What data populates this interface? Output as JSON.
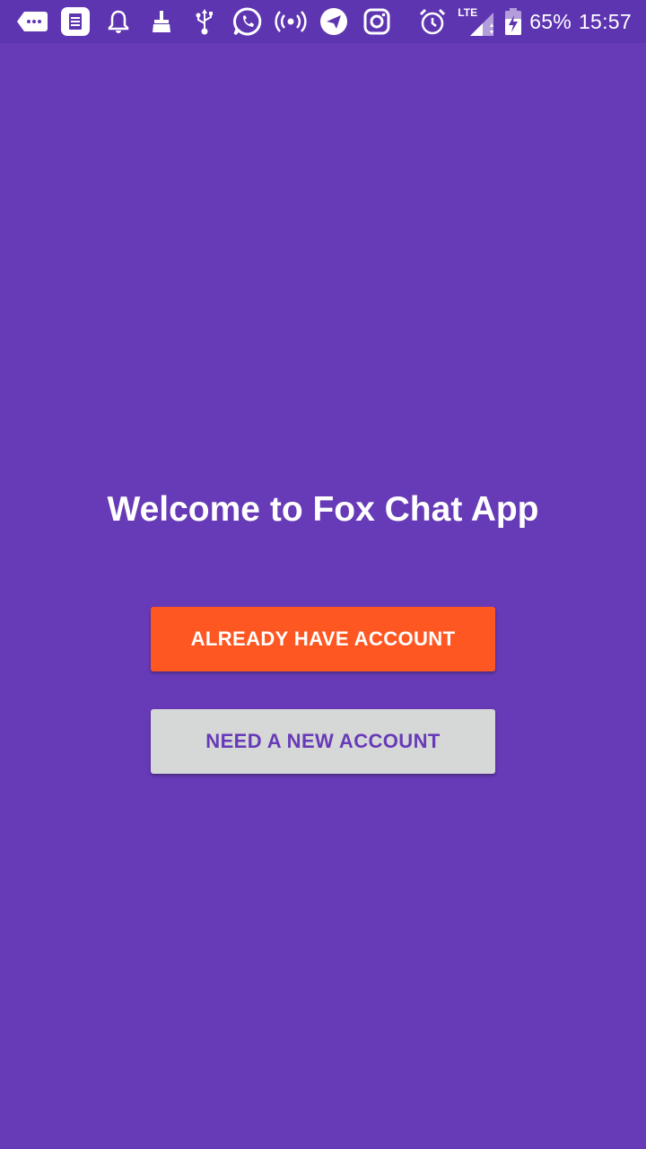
{
  "status_bar": {
    "left_icons": [
      "more-apps-icon",
      "calendar-icon",
      "notification-bell-icon",
      "cleaner-broom-icon",
      "usb-icon",
      "whatsapp-icon",
      "hotspot-broadcast-icon",
      "telegram-icon",
      "instagram-icon"
    ],
    "right_icons": [
      "alarm-icon",
      "lte-signal-icon",
      "battery-charging-icon"
    ],
    "network_label": "LTE",
    "battery": "65%",
    "time": "15:57"
  },
  "main": {
    "title": "Welcome to Fox Chat App",
    "login_button_label": "ALREADY HAVE ACCOUNT",
    "signup_button_label": "NEED A NEW ACCOUNT"
  },
  "colors": {
    "background": "#673ab7",
    "status_bar": "#5e35b1",
    "login_button": "#ff5722",
    "signup_button": "#d6d7d7",
    "signup_text": "#673ab7"
  }
}
